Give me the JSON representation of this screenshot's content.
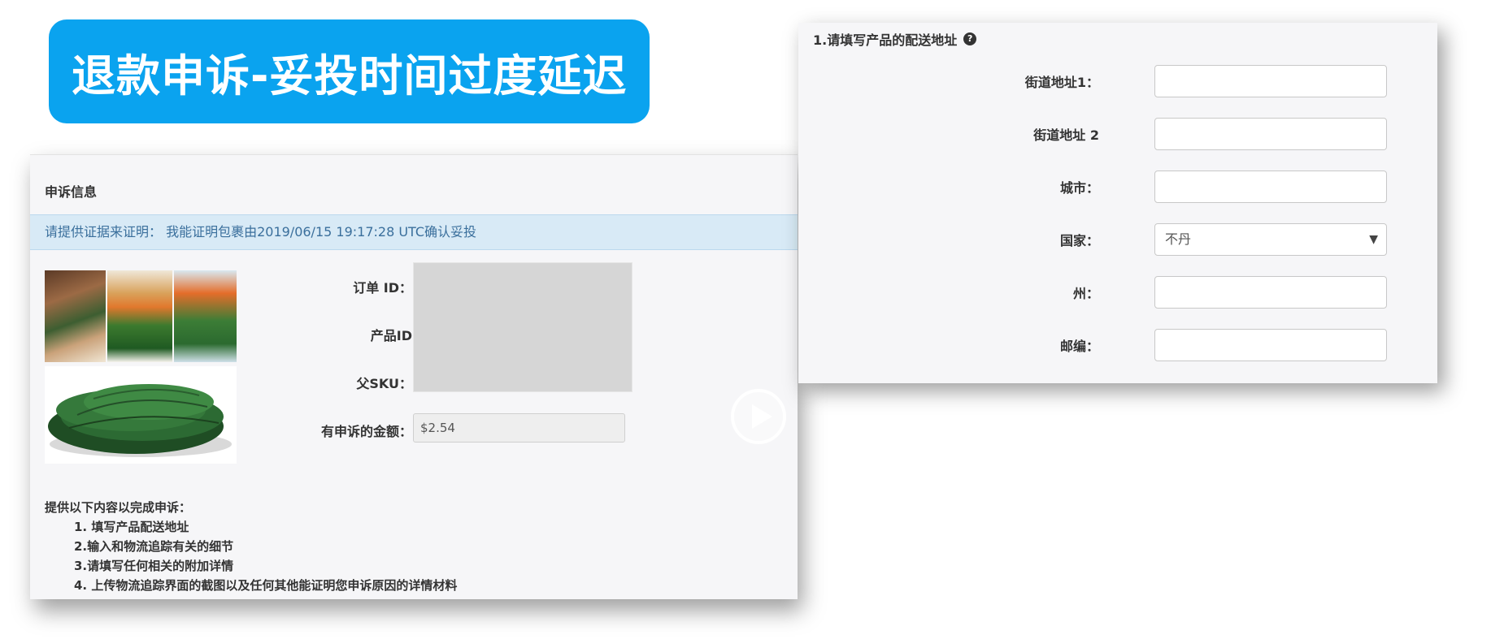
{
  "banner": {
    "title": "退款申诉-妥投时间过度延迟"
  },
  "appeal": {
    "section_title": "申诉信息",
    "info_bar": "请提供证据来证明： 我能证明包裹由2019/06/15 19:17:28 UTC确认妥投",
    "fields": {
      "order_id_label": "订单 ID：",
      "product_id_label": "产品ID",
      "parent_sku_label": "父SKU：",
      "amount_label": "有申诉的金额：",
      "amount_value": "$2.54"
    },
    "instructions": {
      "heading": "提供以下内容以完成申诉：",
      "items": [
        "1. 填写产品配送地址",
        "2.输入和物流追踪有关的细节",
        "3.请填写任何相关的附加详情",
        "4. 上传物流追踪界面的截图以及任何其他能证明您申诉原因的详情材料"
      ]
    }
  },
  "shipping": {
    "title": "1.请填写产品的配送地址",
    "help_icon": "?",
    "fields": [
      {
        "label": "街道地址1：",
        "value": ""
      },
      {
        "label": "街道地址 2",
        "value": ""
      },
      {
        "label": "城市：",
        "value": ""
      },
      {
        "label": "国家：",
        "value": "不丹"
      },
      {
        "label": "州：",
        "value": ""
      },
      {
        "label": "邮编：",
        "value": ""
      }
    ],
    "select_caret": "▼"
  },
  "colors": {
    "banner": "#0aa3ef",
    "info_bar": "#d8eaf6",
    "info_text": "#3a6f9c"
  }
}
